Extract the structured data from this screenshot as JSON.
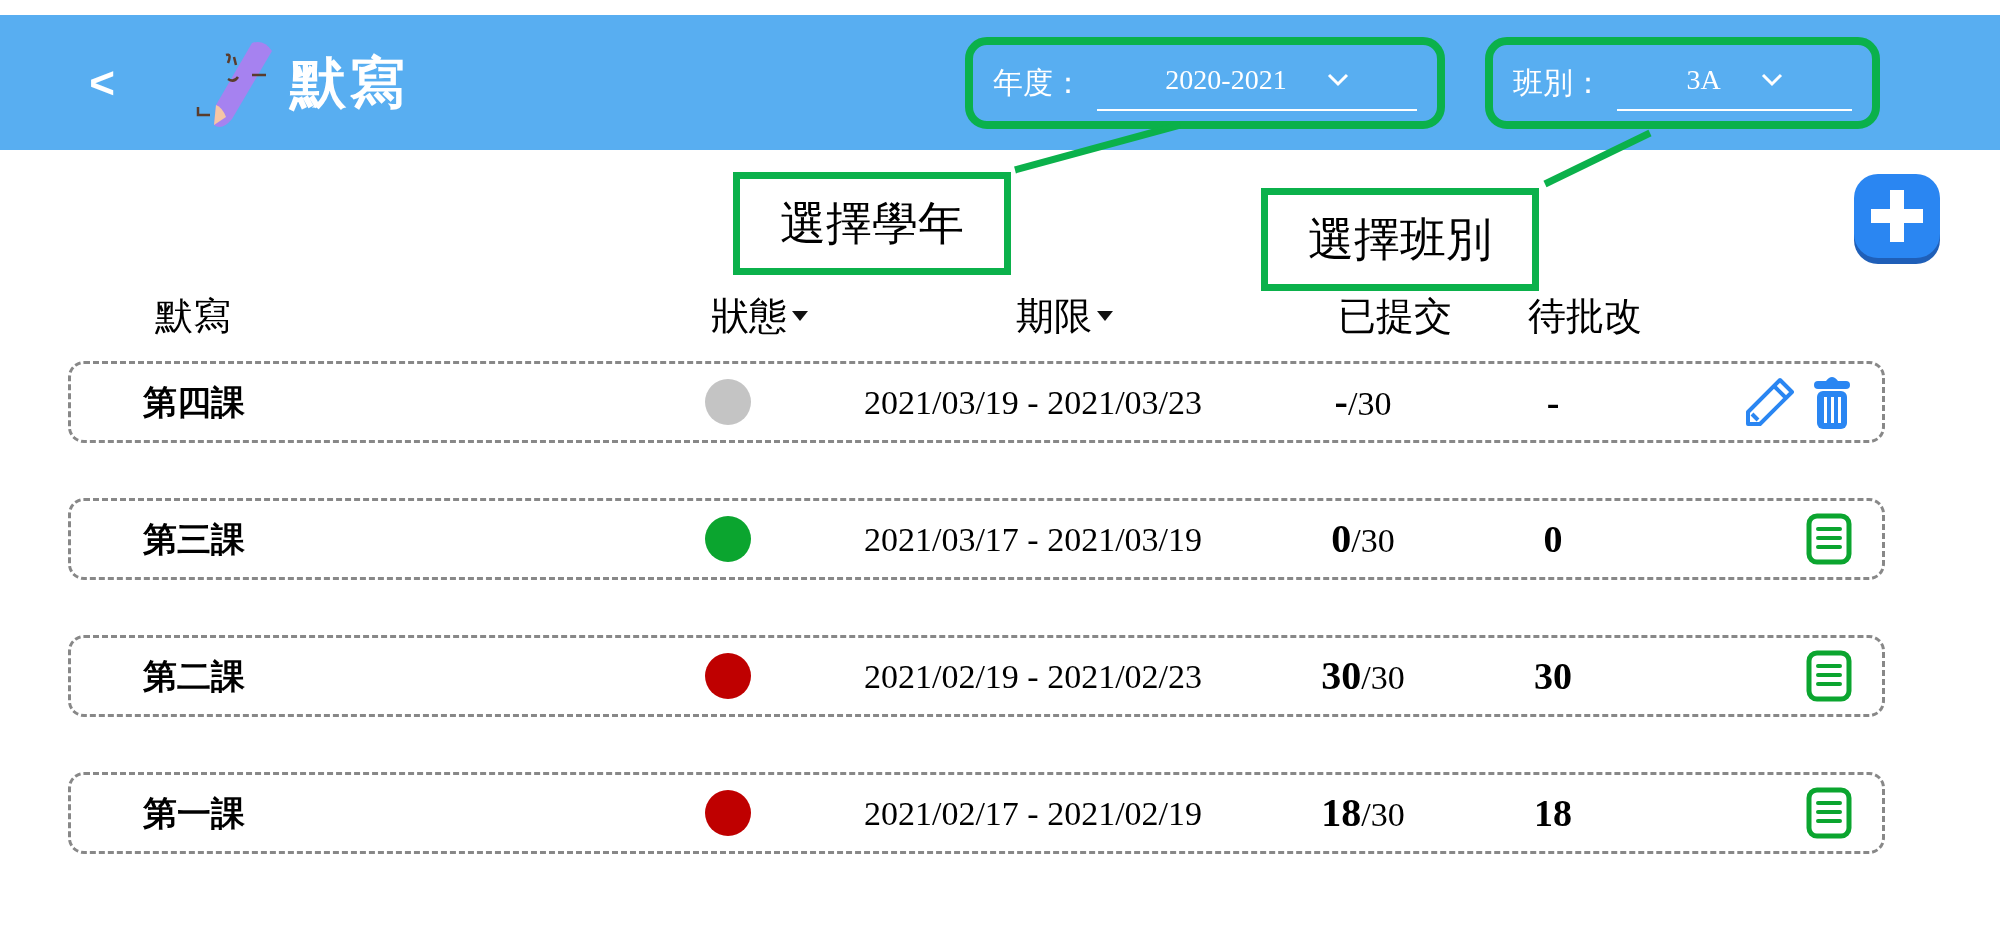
{
  "header": {
    "back": "<",
    "title": "默寫",
    "filters": [
      {
        "label": "年度：",
        "value": "2020-2021",
        "callout": "選擇學年"
      },
      {
        "label": "班別：",
        "value": "3A",
        "callout": "選擇班別"
      }
    ]
  },
  "columns": [
    {
      "label": "默寫",
      "sortable": false
    },
    {
      "label": "狀態",
      "sortable": true
    },
    {
      "label": "期限",
      "sortable": true
    },
    {
      "label": "已提交",
      "sortable": false
    },
    {
      "label": "待批改",
      "sortable": false
    }
  ],
  "rows": [
    {
      "title": "第四課",
      "color": "#c4c4c4",
      "period": "2021/03/19 - 2021/03/23",
      "submitted": "**-**/30",
      "pending": "-",
      "kind": "edit"
    },
    {
      "title": "第三課",
      "color": "#0ba52f",
      "period": "2021/03/17 - 2021/03/19",
      "submitted": "**0**/30",
      "pending": "0",
      "kind": "report"
    },
    {
      "title": "第二課",
      "color": "#bf0000",
      "period": "2021/02/19 - 2021/02/23",
      "submitted": "**30**/30",
      "pending": "30",
      "kind": "report"
    },
    {
      "title": "第一課",
      "color": "#bf0000",
      "period": "2021/02/17 - 2021/02/19",
      "submitted": "**18**/30",
      "pending": "18",
      "kind": "report"
    }
  ]
}
